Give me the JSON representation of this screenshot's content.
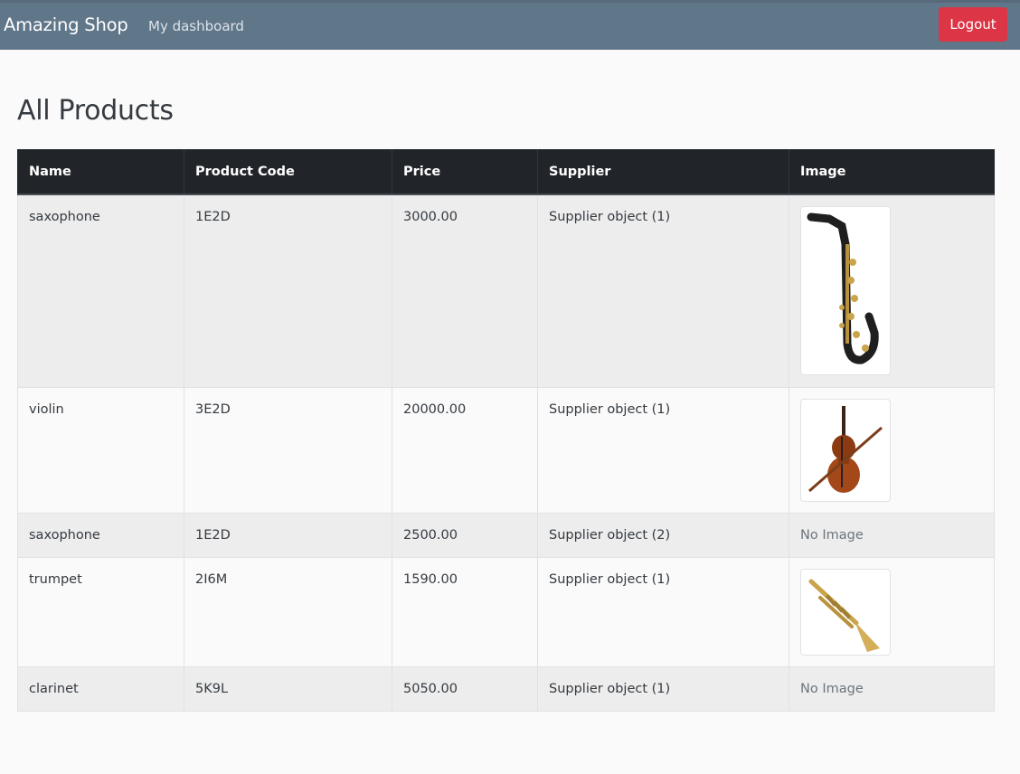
{
  "navbar": {
    "brand": "Amazing Shop",
    "dashboard_link": "My dashboard",
    "logout_label": "Logout"
  },
  "page": {
    "title": "All Products"
  },
  "table": {
    "headers": [
      "Name",
      "Product Code",
      "Price",
      "Supplier",
      "Image"
    ],
    "rows": [
      {
        "name": "saxophone",
        "code": "1E2D",
        "price": "3000.00",
        "supplier": "Supplier object (1)",
        "image": "saxophone-image",
        "image_text": ""
      },
      {
        "name": "violin",
        "code": "3E2D",
        "price": "20000.00",
        "supplier": "Supplier object (1)",
        "image": "violin-image",
        "image_text": ""
      },
      {
        "name": "saxophone",
        "code": "1E2D",
        "price": "2500.00",
        "supplier": "Supplier object (2)",
        "image": "",
        "image_text": "No Image"
      },
      {
        "name": "trumpet",
        "code": "2I6M",
        "price": "1590.00",
        "supplier": "Supplier object (1)",
        "image": "trumpet-image",
        "image_text": ""
      },
      {
        "name": "clarinet",
        "code": "5K9L",
        "price": "5050.00",
        "supplier": "Supplier object (1)",
        "image": "",
        "image_text": "No Image"
      }
    ]
  },
  "colors": {
    "navbar": "#607689",
    "logout": "#dc3545",
    "table_header": "#212529"
  }
}
